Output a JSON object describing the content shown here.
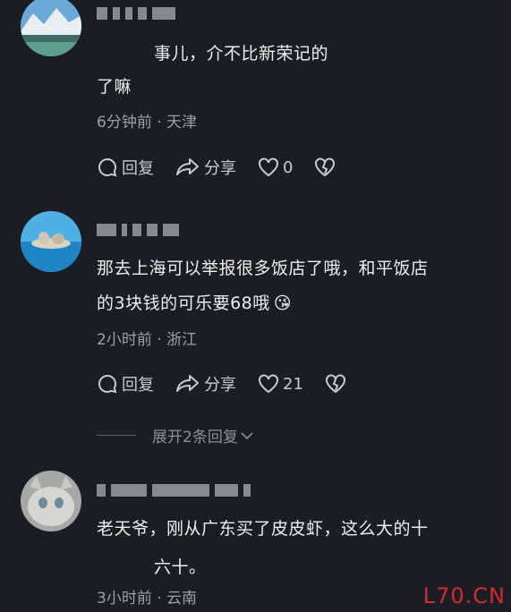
{
  "comments": [
    {
      "text_line1": "事儿，介不比新荣记的",
      "text_line2": "了嘛",
      "time": "6分钟前",
      "location": "天津",
      "reply_label": "回复",
      "share_label": "分享",
      "likes": "0"
    },
    {
      "text_line1": "那去上海可以举报很多饭店了哦，和平饭店",
      "text_line2": "的3块钱的可乐要68哦",
      "emoji": "😘",
      "time": "2小时前",
      "location": "浙江",
      "reply_label": "回复",
      "share_label": "分享",
      "likes": "21",
      "expand_label": "展开2条回复"
    },
    {
      "text_line1": "老天爷，刚从广东买了皮皮虾，这么大的十",
      "text_line2": "六十。",
      "time": "3小时前",
      "location": "云南"
    }
  ],
  "separator": "·",
  "watermark": "L70.CN",
  "colors": {
    "background": "#1b1d25",
    "meta": "#9d9fa8",
    "watermark": "#d62a2a"
  }
}
